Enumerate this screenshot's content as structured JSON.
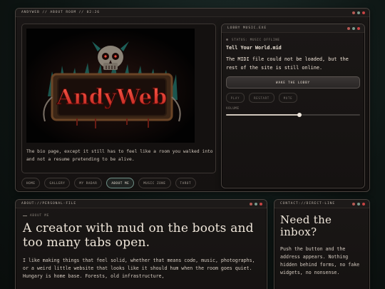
{
  "main_window": {
    "title": "andyweb // about room // 02:26",
    "bio_text": "The bio page, except it still has to feel like a room you walked into and not a resume pretending to be alive.",
    "logo_text": "AndyWeb",
    "tabs": [
      {
        "label": "home",
        "active": false
      },
      {
        "label": "gallery",
        "active": false
      },
      {
        "label": "my radar",
        "active": false
      },
      {
        "label": "about me",
        "active": true
      },
      {
        "label": "music zone",
        "active": false
      },
      {
        "label": "tarot",
        "active": false
      }
    ]
  },
  "music": {
    "title": "lobby music.exe",
    "status": "status: music offline",
    "track": "Tell Your World.mid",
    "error": "The MIDI file could not be loaded, but the rest of the site is still online.",
    "primary_button": "wake the lobby",
    "controls": [
      "play",
      "restart",
      "mute"
    ],
    "volume_label": "volume",
    "volume_fraction": 0.55
  },
  "about": {
    "title": "about://personal-file",
    "section_label": "about me",
    "headline": "A creator with mud on the boots and too many tabs open.",
    "paragraph": "I like making things that feel solid, whether that means code, music, photographs, or a weird little website that looks like it should hum when the room goes quiet. Hungary is home base. Forests, old infrastructure,"
  },
  "contact": {
    "title": "contact://direct-line",
    "headline": "Need the inbox?",
    "text": "Push the button and the address appears. Nothing hidden behind forms, no fake widgets, no nonsense."
  },
  "colors": {
    "background": "#0d1513",
    "panel": "#151211",
    "accent_red": "#c94444",
    "accent_teal": "#6f8f86",
    "text": "#d9cfc4"
  }
}
